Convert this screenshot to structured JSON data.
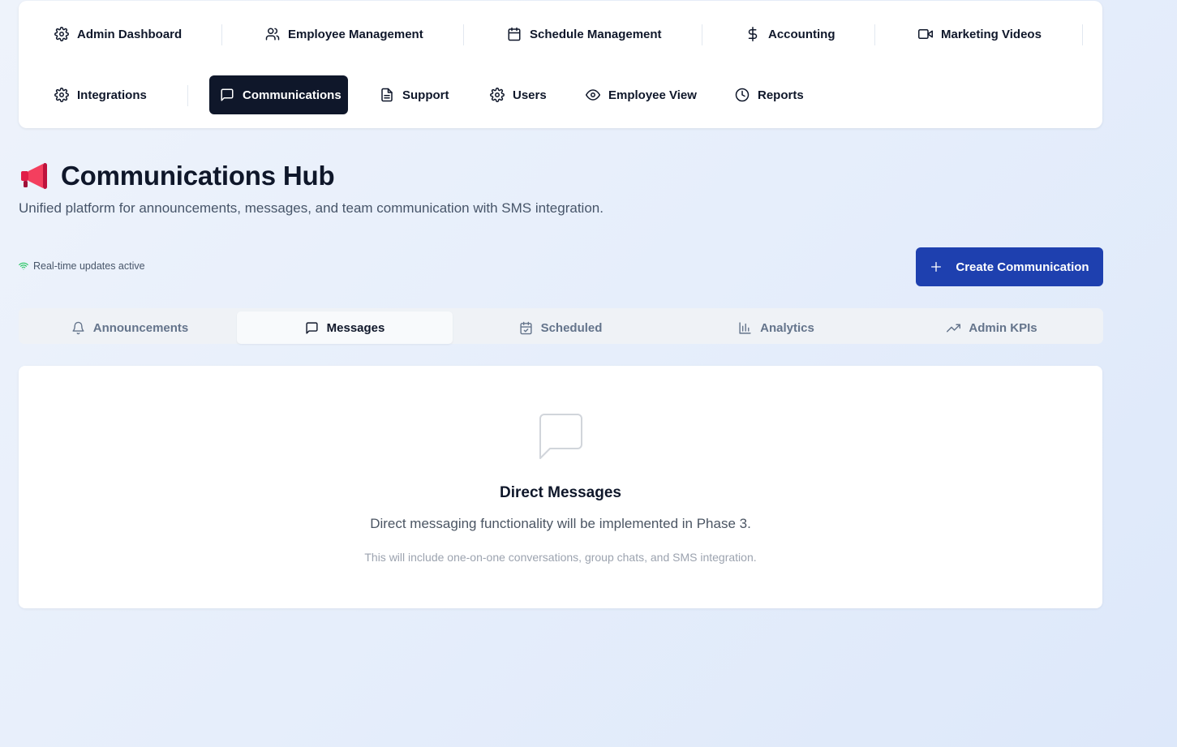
{
  "nav": {
    "items": [
      {
        "label": "Admin Dashboard",
        "icon": "gear-icon"
      },
      {
        "label": "Employee Management",
        "icon": "users-icon"
      },
      {
        "label": "Schedule Management",
        "icon": "calendar-icon"
      },
      {
        "label": "Accounting",
        "icon": "dollar-icon"
      },
      {
        "label": "Marketing Videos",
        "icon": "video-icon"
      },
      {
        "label": "Integrations",
        "icon": "gear-icon"
      },
      {
        "label": "Communications",
        "icon": "message-square-icon",
        "active": true
      },
      {
        "label": "Support",
        "icon": "file-text-icon"
      },
      {
        "label": "Users",
        "icon": "gear-icon"
      },
      {
        "label": "Employee View",
        "icon": "eye-icon"
      },
      {
        "label": "Reports",
        "icon": "clock-icon"
      }
    ]
  },
  "header": {
    "emoji": "📢",
    "title": "Communications Hub",
    "subtitle": "Unified platform for announcements, messages, and team communication with SMS integration."
  },
  "status": {
    "realtime_text": "Real-time updates active",
    "color": "#22c55e"
  },
  "actions": {
    "create_label": "Create Communication"
  },
  "tabs": [
    {
      "label": "Announcements",
      "icon": "bell-icon"
    },
    {
      "label": "Messages",
      "icon": "message-square-icon",
      "active": true
    },
    {
      "label": "Scheduled",
      "icon": "calendar-check-icon"
    },
    {
      "label": "Analytics",
      "icon": "bar-chart-icon"
    },
    {
      "label": "Admin KPIs",
      "icon": "trending-up-icon"
    }
  ],
  "empty_state": {
    "icon": "message-square-icon",
    "title": "Direct Messages",
    "description": "Direct messaging functionality will be implemented in Phase 3.",
    "note": "This will include one-on-one conversations, group chats, and SMS integration."
  },
  "colors": {
    "primary": "#1e40af",
    "active_nav": "#0f172a",
    "background": "#e6eefb"
  }
}
